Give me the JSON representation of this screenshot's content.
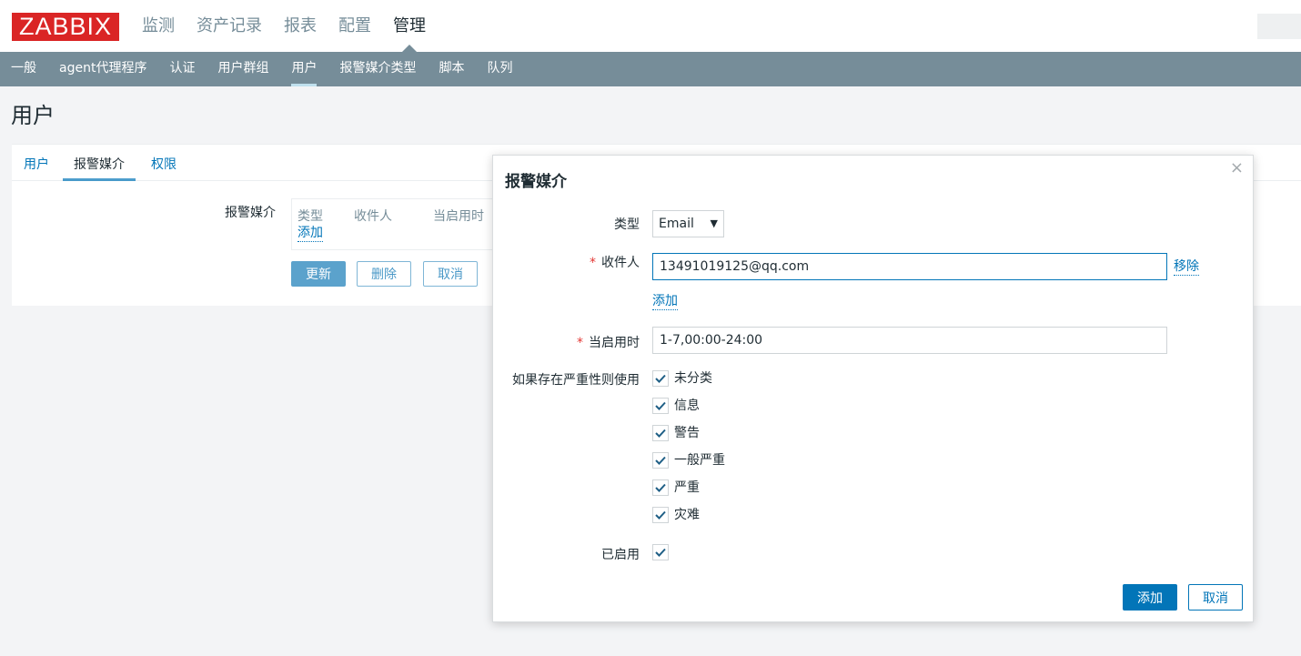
{
  "header": {
    "logo_text": "ZABBIX",
    "main_nav": [
      "监测",
      "资产记录",
      "报表",
      "配置",
      "管理"
    ],
    "main_nav_active": "管理"
  },
  "subnav": {
    "items": [
      "一般",
      "agent代理程序",
      "认证",
      "用户群组",
      "用户",
      "报警媒介类型",
      "脚本",
      "队列"
    ],
    "active": "用户"
  },
  "page": {
    "title": "用户"
  },
  "form": {
    "tabs": [
      "用户",
      "报警媒介",
      "权限"
    ],
    "active_tab": "报警媒介",
    "media_label": "报警媒介",
    "table_headers": [
      "类型",
      "收件人",
      "当启用时"
    ],
    "add_link": "添加",
    "buttons": {
      "update": "更新",
      "delete": "删除",
      "cancel": "取消"
    }
  },
  "modal": {
    "title": "报警媒介",
    "close_glyph": "×",
    "type_label": "类型",
    "type_value": "Email",
    "type_arrow": "▼",
    "required_mark": "*",
    "sendto_label": "收件人",
    "sendto_value": "13491019125@qq.com",
    "remove_link": "移除",
    "add_link": "添加",
    "when_active_label": "当启用时",
    "when_active_value": "1-7,00:00-24:00",
    "severity_label": "如果存在严重性则使用",
    "severities": [
      {
        "label": "未分类",
        "checked": true
      },
      {
        "label": "信息",
        "checked": true
      },
      {
        "label": "警告",
        "checked": true
      },
      {
        "label": "一般严重",
        "checked": true
      },
      {
        "label": "严重",
        "checked": true
      },
      {
        "label": "灾难",
        "checked": true
      }
    ],
    "enabled_label": "已启用",
    "enabled_checked": true,
    "buttons": {
      "add": "添加",
      "cancel": "取消"
    }
  },
  "colors": {
    "accent": "#0275b8",
    "subnav_bg": "#768d99",
    "logo_bg": "#d40000",
    "required": "#e33734"
  }
}
